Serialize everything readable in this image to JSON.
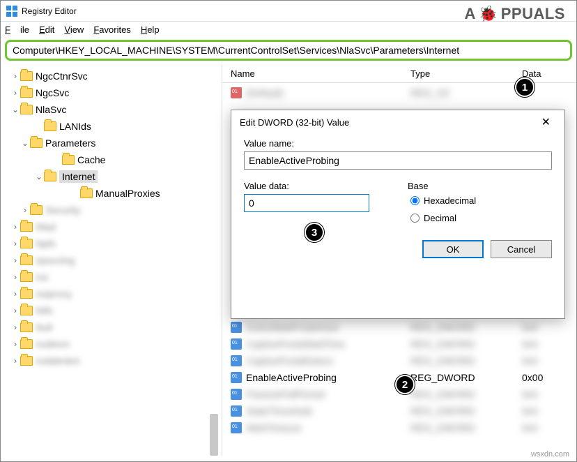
{
  "app": {
    "title": "Registry Editor"
  },
  "menu": {
    "file": "File",
    "edit": "Edit",
    "view": "View",
    "favorites": "Favorites",
    "help": "Help"
  },
  "address": "Computer\\HKEY_LOCAL_MACHINE\\SYSTEM\\CurrentControlSet\\Services\\NlaSvc\\Parameters\\Internet",
  "tree": {
    "items": [
      {
        "label": "NgcCtnrSvc"
      },
      {
        "label": "NgcSvc"
      },
      {
        "label": "NlaSvc"
      },
      {
        "label": "LANIds"
      },
      {
        "label": "Parameters"
      },
      {
        "label": "Cache"
      },
      {
        "label": "Internet"
      },
      {
        "label": "ManualProxies"
      }
    ]
  },
  "columns": {
    "name": "Name",
    "type": "Type",
    "data": "Data"
  },
  "list": {
    "highlight": {
      "name": "EnableActiveProbing",
      "type": "REG_DWORD",
      "data": "0x00"
    }
  },
  "dialog": {
    "title": "Edit DWORD (32-bit) Value",
    "value_name_label": "Value name:",
    "value_name": "EnableActiveProbing",
    "value_data_label": "Value data:",
    "value_data": "0",
    "base_label": "Base",
    "hex": "Hexadecimal",
    "dec": "Decimal",
    "ok": "OK",
    "cancel": "Cancel"
  },
  "badges": {
    "one": "1",
    "two": "2",
    "three": "3"
  },
  "watermark": {
    "pre": "A",
    "post": "PPUALS"
  },
  "corner": "wsxdn.com"
}
